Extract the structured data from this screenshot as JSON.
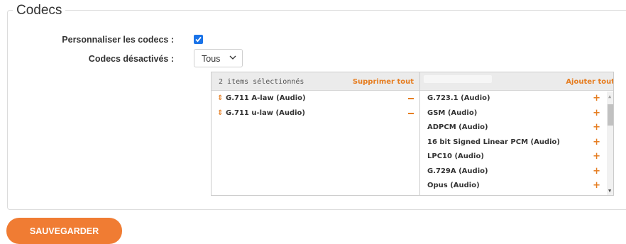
{
  "section": {
    "title": "Codecs"
  },
  "form": {
    "customize_label": "Personnaliser les codecs :",
    "customize_checked": true,
    "disabled_label": "Codecs désactivés :",
    "disabled_value": "Tous"
  },
  "multiselect": {
    "selected_count": "2 items sélectionnés",
    "remove_all": "Supprimer tout",
    "add_all": "Ajouter tout",
    "selected": [
      {
        "label": "G.711 A-law (Audio)"
      },
      {
        "label": "G.711 u-law (Audio)"
      }
    ],
    "available": [
      {
        "label": "G.723.1 (Audio)"
      },
      {
        "label": "GSM (Audio)"
      },
      {
        "label": "ADPCM (Audio)"
      },
      {
        "label": "16 bit Signed Linear PCM (Audio)"
      },
      {
        "label": "LPC10 (Audio)"
      },
      {
        "label": "G.729A (Audio)"
      },
      {
        "label": "Opus (Audio)"
      }
    ]
  },
  "actions": {
    "save_label": "SAUVEGARDER"
  },
  "colors": {
    "accent": "#f07c33",
    "checkbox": "#1a73e8"
  }
}
